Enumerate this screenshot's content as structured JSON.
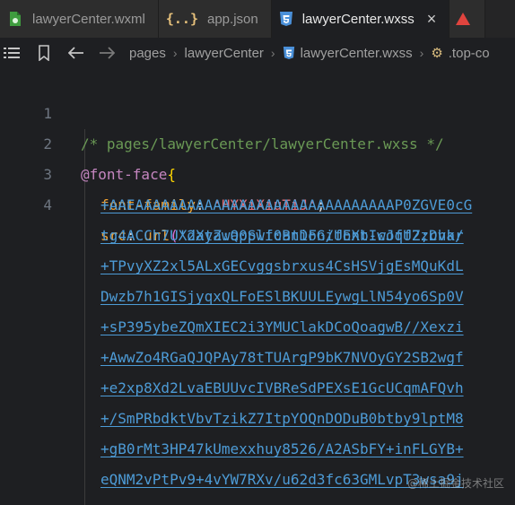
{
  "tabs": [
    {
      "label": "lawyerCenter.wxml",
      "icon": "wxml-file-icon",
      "active": false
    },
    {
      "label": "app.json",
      "icon": "json-braces-icon",
      "active": false
    },
    {
      "label": "lawyerCenter.wxss",
      "icon": "css-file-icon",
      "active": true,
      "close": "×"
    }
  ],
  "breadcrumb": {
    "items": [
      "pages",
      "lawyerCenter",
      "lawyerCenter.wxss",
      ".top-co"
    ]
  },
  "editor": {
    "line_numbers": [
      "1",
      "2",
      "3",
      "4"
    ],
    "lines": {
      "l1_comment": "/* pages/lawyerCenter/lawyerCenter.wxss */",
      "l2_at": "@font-face",
      "l2_brace": "{",
      "l3_prop": "font-family",
      "l3_colon": ": ",
      "l3_value": "'HYXiXiuTiJ'",
      "l3_semi": ";",
      "l4_prop": "src",
      "l4_colon": ": ",
      "l4_func": "url",
      "l4_paren": "(",
      "l4_value": "'data:application/font-woff2;char"
    },
    "wrapped": [
      "+AAEAAAAAAAAAAAAAAAAAAAAAAAAAAAAAAP0ZGVE0cG",
      "tg4ACCh7UX2XyZwQ0Swf0BnDFGiUEXbIcJqUZzDvk/",
      "+TPvyXZ2xl5ALxGECvggsbrxus4CsHSVjgEsMQuKdL",
      "Dwzb7h1GISjyqxQLFoESlBKUULEywgLlN54yo6Sp0V",
      "+sP395ybeZQmXIEC2i3YMUClakDCoQoagwB//Xexzi",
      "+AwwZo4RGaQJQPAy78tTUArgP9bK7NVOyGY2SB2wgf",
      "+e2xp8Xd2LvaEBUUvcIVBReSdPEXsE1GcUCqmAFQvh",
      "+/SmPRbdktVbvTzikZ7ItpYOQnDODuB0btby9lptM8",
      "+gB0rMt3HP47kUmexxhuy8526/A2ASbFY+inFLGYB+",
      "eQNM2vPtPv9+4vYW7RXv/u62d3fc63GMLvpT3wsa9j"
    ]
  },
  "watermark": "@稀土掘金技术社区",
  "colors": {
    "background": "#1e1f22",
    "comment": "#6a9955",
    "at_rule": "#c586c0",
    "property": "#f0a030",
    "string": "#e06c75",
    "url": "#4d9bd6"
  }
}
